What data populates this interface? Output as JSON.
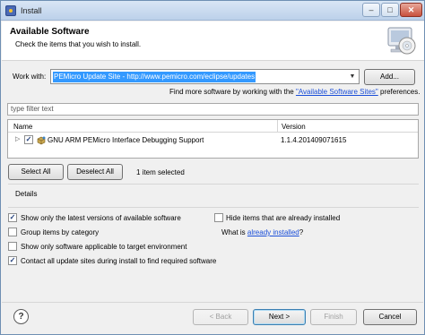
{
  "window": {
    "title": "Install",
    "controls": {
      "minimize": "–",
      "maximize": "□",
      "close": "✕"
    }
  },
  "banner": {
    "title": "Available Software",
    "description": "Check the items that you wish to install.",
    "icon": "install-cd-icon"
  },
  "work_with": {
    "label": "Work with:",
    "value": "PEMicro Update Site - http://www.pemicro.com/eclipse/updates",
    "add_button": "Add...",
    "hint_prefix": "Find more software by working with the ",
    "hint_link": "\"Available Software Sites\"",
    "hint_suffix": " preferences."
  },
  "filter": {
    "placeholder": "type filter text"
  },
  "table": {
    "columns": [
      "Name",
      "Version"
    ],
    "rows": [
      {
        "checked": true,
        "name": "GNU ARM PEMicro Interface Debugging Support",
        "version": "1.1.4.201409071615"
      }
    ]
  },
  "selection": {
    "select_all": "Select All",
    "deselect_all": "Deselect All",
    "status": "1 item selected"
  },
  "details": {
    "label": "Details"
  },
  "options": [
    {
      "label": "Show only the latest versions of available software",
      "checked": true
    },
    {
      "label": "Group items by category",
      "checked": false
    },
    {
      "label": "Show only software applicable to target environment",
      "checked": false
    },
    {
      "label": "Contact all update sites during install to find required software",
      "checked": true
    }
  ],
  "right_options": {
    "hide_installed": {
      "label": "Hide items that are already installed",
      "checked": false
    },
    "what_is_prefix": "What is ",
    "what_is_link": "already installed",
    "what_is_suffix": "?"
  },
  "footer": {
    "help": "?",
    "back": "< Back",
    "next": "Next >",
    "finish": "Finish",
    "cancel": "Cancel"
  },
  "colors": {
    "selection": "#3399ff",
    "link": "#1a4ed8",
    "window_bg": "#f0f0f0"
  }
}
